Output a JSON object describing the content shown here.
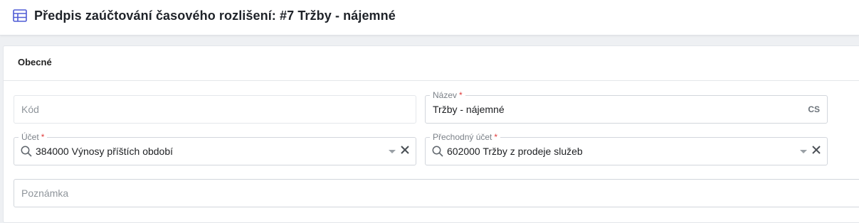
{
  "header": {
    "title": "Předpis zaúčtování časového rozlišení: #7 Tržby - nájemné",
    "icon": "table-icon"
  },
  "section": {
    "title": "Obecné"
  },
  "fields": {
    "kod": {
      "placeholder": "Kód",
      "value": ""
    },
    "nazev": {
      "label": "Název",
      "required_mark": "*",
      "value": "Tržby - nájemné",
      "lang": "CS"
    },
    "ucet": {
      "label": "Účet",
      "required_mark": "*",
      "value": "384000 Výnosy příštích období"
    },
    "prechodny_ucet": {
      "label": "Přechodný účet",
      "required_mark": "*",
      "value": "602000 Tržby z prodeje služeb"
    },
    "poznamka": {
      "placeholder": "Poznámka",
      "value": ""
    }
  },
  "colors": {
    "accent": "#4f5bd5",
    "required": "#e03a3a",
    "background": "#eef0f3"
  }
}
